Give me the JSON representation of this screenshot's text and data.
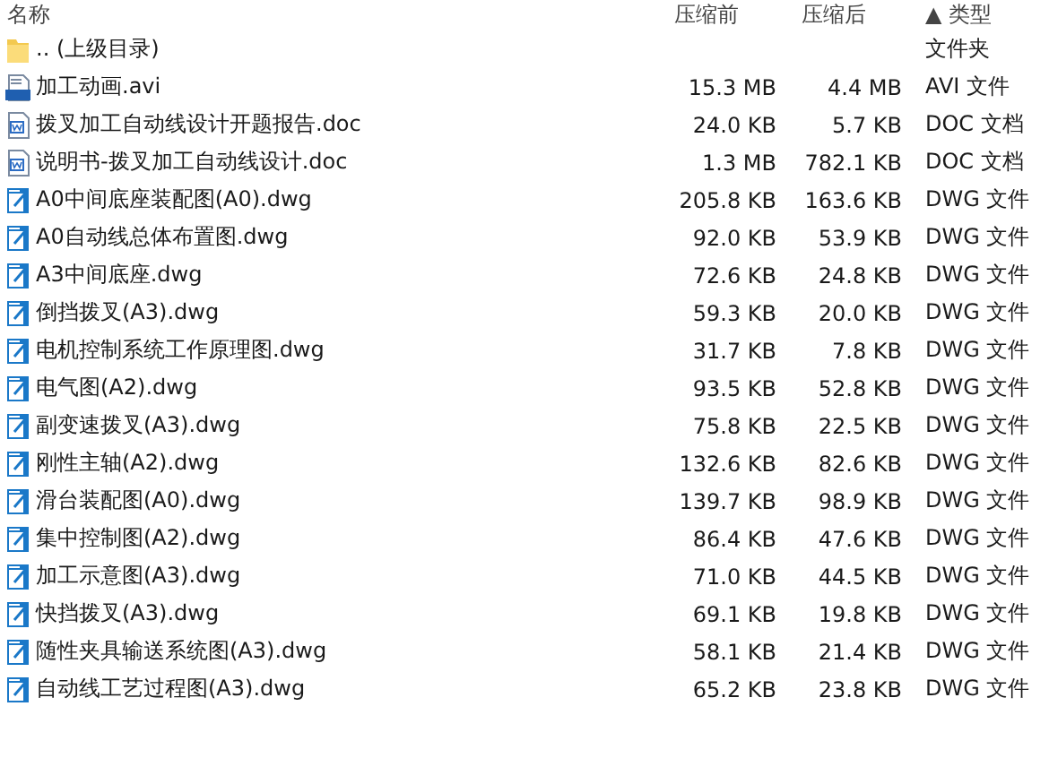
{
  "columns": [
    "名称",
    "压缩前",
    "压缩后",
    "▲ 类型"
  ],
  "rows": [
    {
      "kind": "folder",
      "name": ".. (上级目录)",
      "size": "",
      "packed": "",
      "type": "文件夹"
    },
    {
      "kind": "avi",
      "name": "加工动画.avi",
      "size": "15.3 MB",
      "packed": "4.4 MB",
      "type": "AVI 文件"
    },
    {
      "kind": "doc",
      "name": "拨叉加工自动线设计开题报告.doc",
      "size": "24.0 KB",
      "packed": "5.7 KB",
      "type": "DOC 文档"
    },
    {
      "kind": "doc",
      "name": "说明书-拨叉加工自动线设计.doc",
      "size": "1.3 MB",
      "packed": "782.1 KB",
      "type": "DOC 文档"
    },
    {
      "kind": "dwg",
      "name": "A0中间底座装配图(A0).dwg",
      "size": "205.8 KB",
      "packed": "163.6 KB",
      "type": "DWG 文件"
    },
    {
      "kind": "dwg",
      "name": "A0自动线总体布置图.dwg",
      "size": "92.0 KB",
      "packed": "53.9 KB",
      "type": "DWG 文件"
    },
    {
      "kind": "dwg",
      "name": "A3中间底座.dwg",
      "size": "72.6 KB",
      "packed": "24.8 KB",
      "type": "DWG 文件"
    },
    {
      "kind": "dwg",
      "name": "倒挡拨叉(A3).dwg",
      "size": "59.3 KB",
      "packed": "20.0 KB",
      "type": "DWG 文件"
    },
    {
      "kind": "dwg",
      "name": "电机控制系统工作原理图.dwg",
      "size": "31.7 KB",
      "packed": "7.8 KB",
      "type": "DWG 文件"
    },
    {
      "kind": "dwg",
      "name": "电气图(A2).dwg",
      "size": "93.5 KB",
      "packed": "52.8 KB",
      "type": "DWG 文件"
    },
    {
      "kind": "dwg",
      "name": "副变速拨叉(A3).dwg",
      "size": "75.8 KB",
      "packed": "22.5 KB",
      "type": "DWG 文件"
    },
    {
      "kind": "dwg",
      "name": "刚性主轴(A2).dwg",
      "size": "132.6 KB",
      "packed": "82.6 KB",
      "type": "DWG 文件"
    },
    {
      "kind": "dwg",
      "name": "滑台装配图(A0).dwg",
      "size": "139.7 KB",
      "packed": "98.9 KB",
      "type": "DWG 文件"
    },
    {
      "kind": "dwg",
      "name": "集中控制图(A2).dwg",
      "size": "86.4 KB",
      "packed": "47.6 KB",
      "type": "DWG 文件"
    },
    {
      "kind": "dwg",
      "name": "加工示意图(A3).dwg",
      "size": "71.0 KB",
      "packed": "44.5 KB",
      "type": "DWG 文件"
    },
    {
      "kind": "dwg",
      "name": "快挡拨叉(A3).dwg",
      "size": "69.1 KB",
      "packed": "19.8 KB",
      "type": "DWG 文件"
    },
    {
      "kind": "dwg",
      "name": "随性夹具输送系统图(A3).dwg",
      "size": "58.1 KB",
      "packed": "21.4 KB",
      "type": "DWG 文件"
    },
    {
      "kind": "dwg",
      "name": "自动线工艺过程图(A3).dwg",
      "size": "65.2 KB",
      "packed": "23.8 KB",
      "type": "DWG 文件"
    }
  ]
}
